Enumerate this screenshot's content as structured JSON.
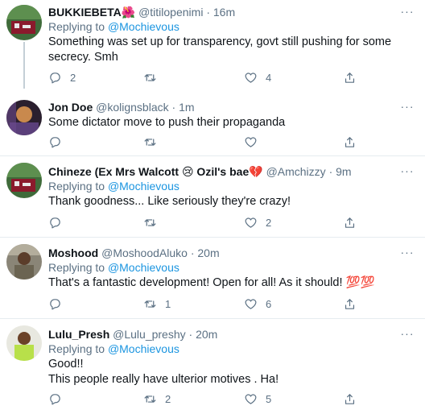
{
  "tweets": [
    {
      "name": "BUKKIEBETA",
      "name_emoji": "🌺",
      "handle": "@titilopenimi",
      "time": "16m",
      "replying_prefix": "Replying to",
      "replying_to": "@Mochievous",
      "text": "Something was set up for transparency, govt still pushing for some secrecy. Smh",
      "reply_count": "2",
      "retweet_count": "",
      "like_count": "4"
    },
    {
      "name": "Jon Doe",
      "handle": "@kolignsblack",
      "time": "1m",
      "text": "Some dictator move to push their propaganda",
      "reply_count": "",
      "retweet_count": "",
      "like_count": ""
    },
    {
      "name": "Chineze (Ex Mrs Walcott 😢 Ozil's bae💔",
      "handle": "@Amchizzy",
      "time": "9m",
      "replying_prefix": "Replying to",
      "replying_to": "@Mochievous",
      "text": "Thank goodness... Like seriously they're crazy!",
      "reply_count": "",
      "retweet_count": "",
      "like_count": "2"
    },
    {
      "name": "Moshood",
      "handle": "@MoshoodAluko",
      "time": "20m",
      "replying_prefix": "Replying to",
      "replying_to": "@Mochievous",
      "text": "That's a fantastic development! Open for all! As it should! 💯💯",
      "reply_count": "",
      "retweet_count": "1",
      "like_count": "6"
    },
    {
      "name": "Lulu_Presh",
      "handle": "@Lulu_preshy",
      "time": "20m",
      "replying_prefix": "Replying to",
      "replying_to": "@Mochievous",
      "text_line1": "Good!!",
      "text_line2": "This people really have ulterior motives . Ha!",
      "reply_count": "",
      "retweet_count": "2",
      "like_count": "5"
    }
  ],
  "dot": "·",
  "more_glyph": "···",
  "colors": {
    "link": "#1b95e0",
    "secondary": "#5b7083",
    "divider": "#e6ecf0"
  }
}
